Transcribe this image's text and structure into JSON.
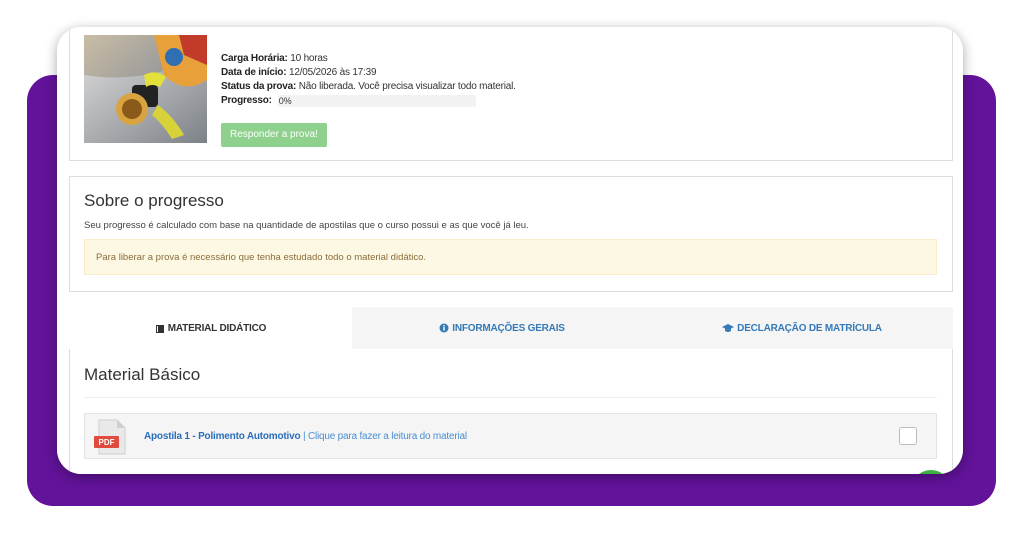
{
  "course": {
    "workload_label": "Carga Horária:",
    "workload_value": "10 horas",
    "start_label": "Data de início:",
    "start_value": "12/05/2026 às 17:39",
    "status_label": "Status da prova:",
    "status_value": "Não liberada. Você precisa visualizar todo material.",
    "progress_label": "Progresso:",
    "progress_text": "0%",
    "progress_value": 0,
    "exam_button": "Responder a prova!"
  },
  "about": {
    "title": "Sobre o progresso",
    "description": "Seu progresso é calculado com base na quantidade de apostilas que o curso possui e as que você já leu.",
    "alert": "Para liberar a prova é necessário que tenha estudado todo o material didático."
  },
  "tabs": [
    {
      "label": "MATERIAL DIDÁTICO",
      "icon": "book-icon",
      "active": true
    },
    {
      "label": "INFORMAÇÕES GERAIS",
      "icon": "info-circle-icon",
      "active": false
    },
    {
      "label": "DECLARAÇÃO DE MATRÍCULA",
      "icon": "graduation-cap-icon",
      "active": false
    }
  ],
  "content": {
    "section_title": "Material Básico",
    "materials": [
      {
        "title": "Apostila 1 - Polimento Automotivo",
        "hint": "| Clique para fazer a leitura do material",
        "icon_label": "PDF"
      }
    ]
  },
  "colors": {
    "brand_purple": "#62139a",
    "link_blue": "#337ab7",
    "success_green": "#8dd18d",
    "warning_bg": "#fcf8e3",
    "warning_text": "#8a6d3b"
  }
}
